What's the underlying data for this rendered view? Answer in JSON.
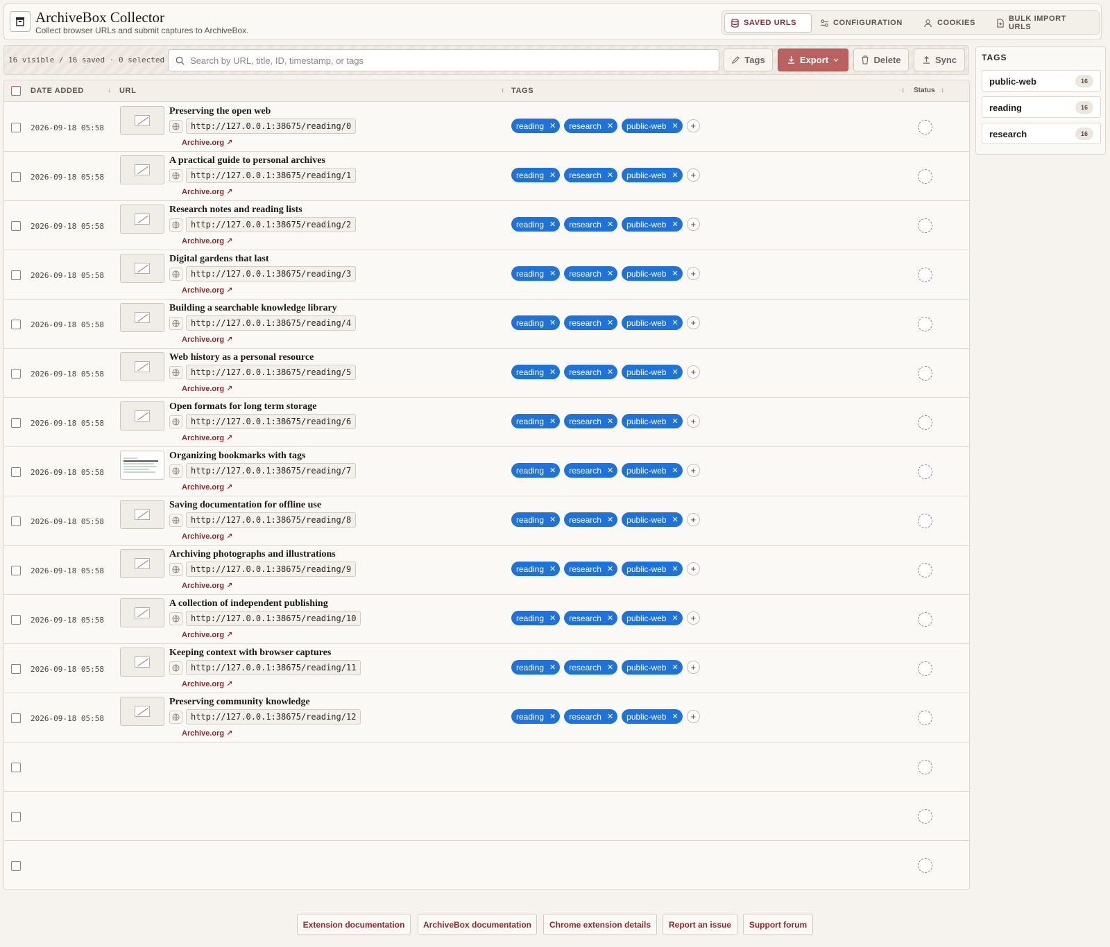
{
  "app": {
    "title": "ArchiveBox Collector",
    "subtitle": "Collect browser URLs and submit captures to ArchiveBox."
  },
  "nav": {
    "tabs": [
      {
        "label": "SAVED URLS",
        "icon": "database-icon",
        "active": true
      },
      {
        "label": "CONFIGURATION",
        "icon": "settings-sliders-icon",
        "active": false
      },
      {
        "label": "COOKIES",
        "icon": "user-icon",
        "active": false
      },
      {
        "label": "BULK IMPORT URLS",
        "icon": "file-import-icon",
        "active": false
      }
    ]
  },
  "toolbar": {
    "counts": "16 visible / 16 saved · 0 selected",
    "search_placeholder": "Search by URL, title, ID, timestamp, or tags",
    "tags_label": "Tags",
    "export_label": "Export",
    "delete_label": "Delete",
    "sync_label": "Sync"
  },
  "table": {
    "headers": {
      "date": "DATE ADDED",
      "url": "URL",
      "tags": "TAGS",
      "status": "Status"
    },
    "archive_link_label": "Archive.org ↗",
    "rows": [
      {
        "date": "2026-09-18 05:58",
        "title": "Preserving the open web",
        "url": "http://127.0.0.1:38675/reading/0",
        "tags": [
          "reading",
          "research",
          "public-web"
        ],
        "screenshot": false
      },
      {
        "date": "2026-09-18 05:58",
        "title": "A practical guide to personal archives",
        "url": "http://127.0.0.1:38675/reading/1",
        "tags": [
          "reading",
          "research",
          "public-web"
        ],
        "screenshot": false
      },
      {
        "date": "2026-09-18 05:58",
        "title": "Research notes and reading lists",
        "url": "http://127.0.0.1:38675/reading/2",
        "tags": [
          "reading",
          "research",
          "public-web"
        ],
        "screenshot": false
      },
      {
        "date": "2026-09-18 05:58",
        "title": "Digital gardens that last",
        "url": "http://127.0.0.1:38675/reading/3",
        "tags": [
          "reading",
          "research",
          "public-web"
        ],
        "screenshot": false
      },
      {
        "date": "2026-09-18 05:58",
        "title": "Building a searchable knowledge library",
        "url": "http://127.0.0.1:38675/reading/4",
        "tags": [
          "reading",
          "research",
          "public-web"
        ],
        "screenshot": false
      },
      {
        "date": "2026-09-18 05:58",
        "title": "Web history as a personal resource",
        "url": "http://127.0.0.1:38675/reading/5",
        "tags": [
          "reading",
          "research",
          "public-web"
        ],
        "screenshot": false
      },
      {
        "date": "2026-09-18 05:58",
        "title": "Open formats for long term storage",
        "url": "http://127.0.0.1:38675/reading/6",
        "tags": [
          "reading",
          "research",
          "public-web"
        ],
        "screenshot": false
      },
      {
        "date": "2026-09-18 05:58",
        "title": "Organizing bookmarks with tags",
        "url": "http://127.0.0.1:38675/reading/7",
        "tags": [
          "reading",
          "research",
          "public-web"
        ],
        "screenshot": true
      },
      {
        "date": "2026-09-18 05:58",
        "title": "Saving documentation for offline use",
        "url": "http://127.0.0.1:38675/reading/8",
        "tags": [
          "reading",
          "research",
          "public-web"
        ],
        "screenshot": false
      },
      {
        "date": "2026-09-18 05:58",
        "title": "Archiving photographs and illustrations",
        "url": "http://127.0.0.1:38675/reading/9",
        "tags": [
          "reading",
          "research",
          "public-web"
        ],
        "screenshot": false
      },
      {
        "date": "2026-09-18 05:58",
        "title": "A collection of independent publishing",
        "url": "http://127.0.0.1:38675/reading/10",
        "tags": [
          "reading",
          "research",
          "public-web"
        ],
        "screenshot": false
      },
      {
        "date": "2026-09-18 05:58",
        "title": "Keeping context with browser captures",
        "url": "http://127.0.0.1:38675/reading/11",
        "tags": [
          "reading",
          "research",
          "public-web"
        ],
        "screenshot": false
      },
      {
        "date": "2026-09-18 05:58",
        "title": "Preserving community knowledge",
        "url": "http://127.0.0.1:38675/reading/12",
        "tags": [
          "reading",
          "research",
          "public-web"
        ],
        "screenshot": false
      },
      {
        "empty": true
      },
      {
        "empty": true
      },
      {
        "empty": true
      }
    ]
  },
  "sidebar": {
    "title": "TAGS",
    "tags": [
      {
        "label": "public-web",
        "count": "16"
      },
      {
        "label": "reading",
        "count": "16"
      },
      {
        "label": "research",
        "count": "16"
      }
    ]
  },
  "footer": {
    "links": [
      "Extension documentation",
      "ArchiveBox documentation",
      "Chrome extension details",
      "Report an issue",
      "Support forum"
    ]
  },
  "colors": {
    "accent": "#8c2a2a",
    "tag_blue": "#1e72d8",
    "export_button": "#b9625f",
    "background": "#f6f3ee"
  }
}
